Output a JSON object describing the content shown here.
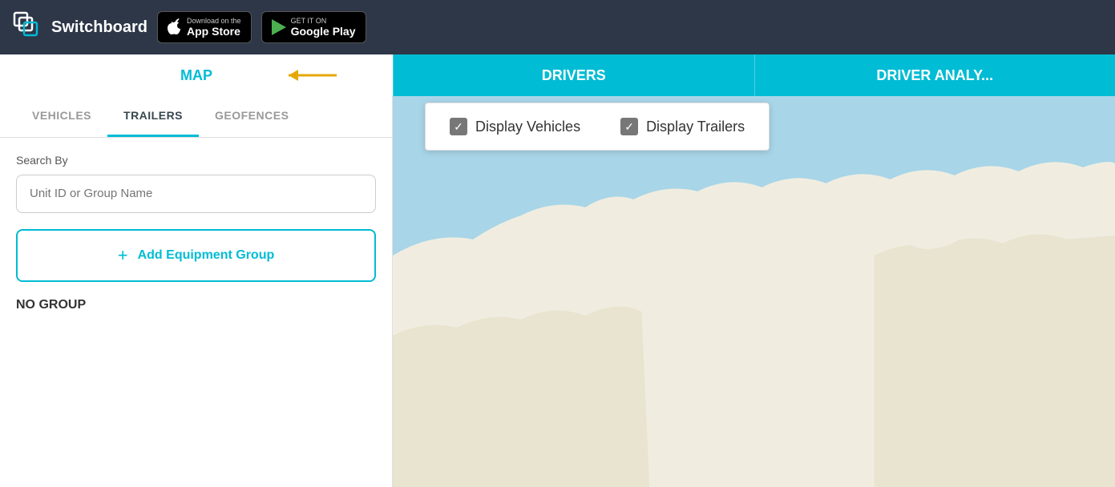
{
  "navbar": {
    "logo_text": "Switchboard",
    "app_store": {
      "small_text": "Download on the",
      "large_text": "App Store"
    },
    "google_play": {
      "small_text": "GET IT ON",
      "large_text": "Google Play"
    }
  },
  "main_tabs": {
    "map_label": "MAP",
    "drivers_label": "DRIVERS",
    "driver_analysis_label": "DRIVER ANALY..."
  },
  "sub_tabs": {
    "vehicles_label": "VEHICLES",
    "trailers_label": "TRAILERS",
    "geofences_label": "GEOFENCES"
  },
  "sidebar": {
    "search_by_label": "Search By",
    "search_placeholder": "Unit ID or Group Name",
    "add_group_label": "Add Equipment Group",
    "no_group_label": "NO GROUP"
  },
  "display_options": {
    "vehicles_label": "Display Vehicles",
    "trailers_label": "Display Trailers"
  },
  "colors": {
    "teal": "#00bcd4",
    "dark_nav": "#2d3748"
  }
}
